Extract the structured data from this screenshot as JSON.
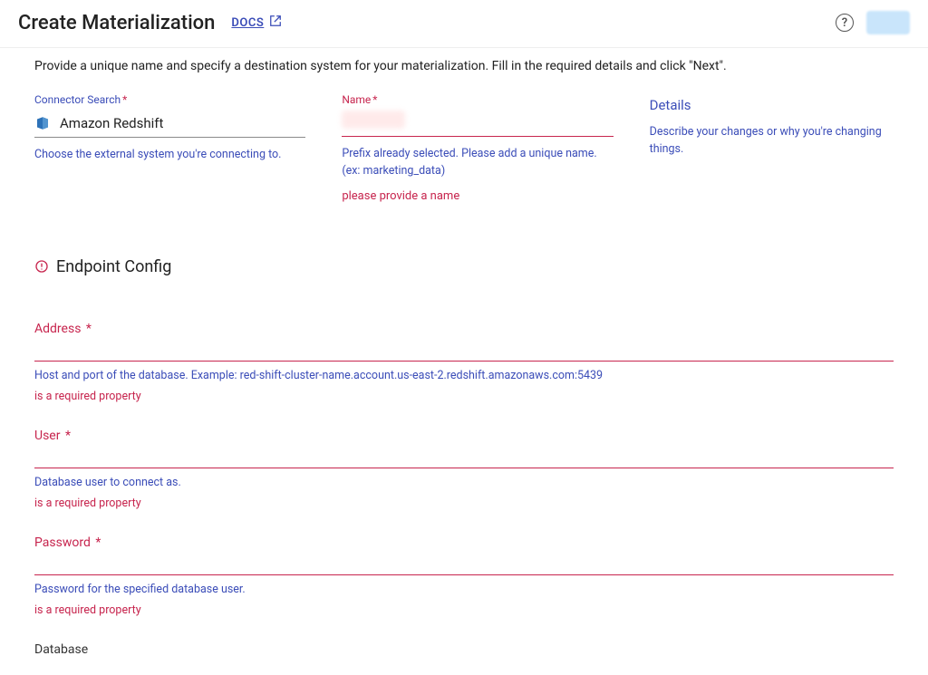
{
  "header": {
    "title": "Create Materialization",
    "docs_label": "DOCS"
  },
  "instructions": "Provide a unique name and specify a destination system for your materialization. Fill in the required details and click \"Next\".",
  "connector": {
    "label": "Connector Search",
    "value": "Amazon Redshift",
    "help": "Choose the external system you're connecting to."
  },
  "name": {
    "label": "Name",
    "help": "Prefix already selected. Please add a unique name. (ex: marketing_data)",
    "error": "please provide a name"
  },
  "details": {
    "title": "Details",
    "help": "Describe your changes or why you're changing things."
  },
  "endpoint": {
    "title": "Endpoint Config",
    "fields": [
      {
        "label": "Address",
        "required": true,
        "help": "Host and port of the database. Example: red-shift-cluster-name.account.us-east-2.redshift.amazonaws.com:5439",
        "error": "is a required property"
      },
      {
        "label": "User",
        "required": true,
        "help": "Database user to connect as.",
        "error": "is a required property"
      },
      {
        "label": "Password",
        "required": true,
        "help": "Password for the specified database user.",
        "error": "is a required property"
      }
    ],
    "cutoff_label": "Database"
  }
}
